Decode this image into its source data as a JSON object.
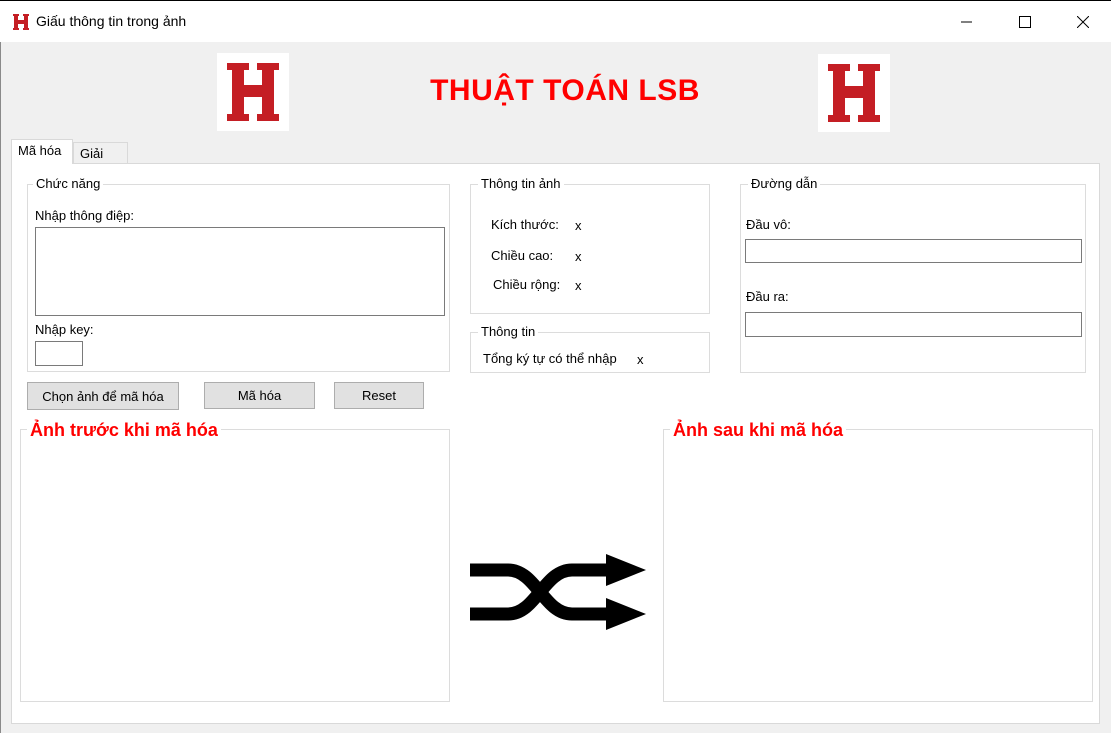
{
  "window": {
    "title": "Giấu thông tin trong ảnh",
    "icon": "h-logo-icon",
    "controls": [
      "minimize-icon",
      "maximize-icon",
      "close-icon"
    ]
  },
  "header": {
    "title": "THUẬT TOÁN LSB",
    "title_color": "#ff0000",
    "logo_color": "#c41e24"
  },
  "tabs": [
    {
      "label": "Mã hóa",
      "active": true
    },
    {
      "label": "Giải mã",
      "active": false
    }
  ],
  "chuc_nang": {
    "legend": "Chức năng",
    "message_label": "Nhập thông điệp:",
    "message_value": "",
    "key_label": "Nhập key:",
    "key_value": ""
  },
  "thong_tin_anh": {
    "legend": "Thông tin ảnh",
    "rows": [
      {
        "label": "Kích thước:",
        "value": "x"
      },
      {
        "label": "Chiều cao:",
        "value": "x"
      },
      {
        "label": "Chiều rộng:",
        "value": "x"
      }
    ]
  },
  "thong_tin": {
    "legend": "Thông tin",
    "label": "Tổng ký tự có thể nhập",
    "value": "x"
  },
  "duong_dan": {
    "legend": "Đường dẫn",
    "input_label": "Đầu vô:",
    "input_value": "",
    "output_label": "Đầu ra:",
    "output_value": ""
  },
  "buttons": {
    "choose_image": "Chọn ảnh để mã hóa",
    "encode": "Mã hóa",
    "reset": "Reset"
  },
  "images": {
    "before_legend": "Ảnh trước khi mã hóa",
    "after_legend": "Ảnh sau khi mã hóa",
    "center_icon": "shuffle-icon"
  }
}
